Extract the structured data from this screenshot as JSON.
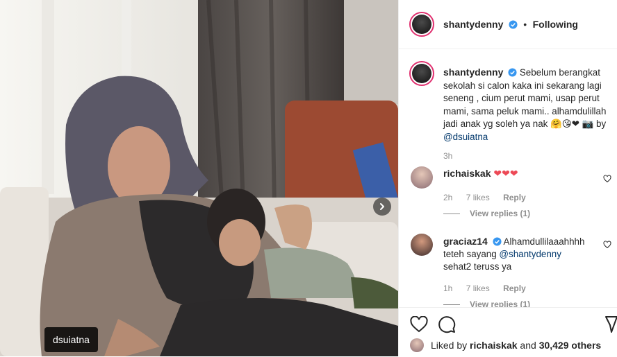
{
  "post": {
    "username": "shantydenny",
    "follow_status": "Following",
    "photo_tag": "dsuiatna",
    "caption": {
      "username": "shantydenny",
      "text": "Sebelum berangkat sekolah si calon kaka ini sekarang lagi seneng , cium perut mami, usap perut mami, sama peluk mami.. alhamdulillah jadi anak yg soleh ya nak 🤗😘❤ 📷 by ",
      "mention": "@dsuiatna",
      "time": "3h"
    }
  },
  "comments": [
    {
      "username": "richaiskak",
      "text": "❤❤❤",
      "time": "2h",
      "likes": "7 likes",
      "reply": "Reply",
      "view_replies": "View replies (1)"
    },
    {
      "username": "graciaz14",
      "text_before": "Alhamdullilaaahhhh teteh sayang ",
      "mention": "@shantydenny",
      "text_after": " sehat2 teruss ya",
      "time": "1h",
      "likes": "7 likes",
      "reply": "Reply",
      "view_replies": "View replies (1)"
    }
  ],
  "footer": {
    "liked_by_prefix": "Liked by ",
    "liked_by_user": "richaiskak",
    "liked_by_mid": " and ",
    "liked_by_count": "30,429 others"
  },
  "icons": {
    "verified": "verified-badge-icon",
    "like": "heart-icon",
    "comment": "comment-icon",
    "next": "chevron-right-icon"
  },
  "colors": {
    "verified_blue": "#3897f0",
    "heart_red": "#ed4956",
    "link": "#00376b"
  }
}
